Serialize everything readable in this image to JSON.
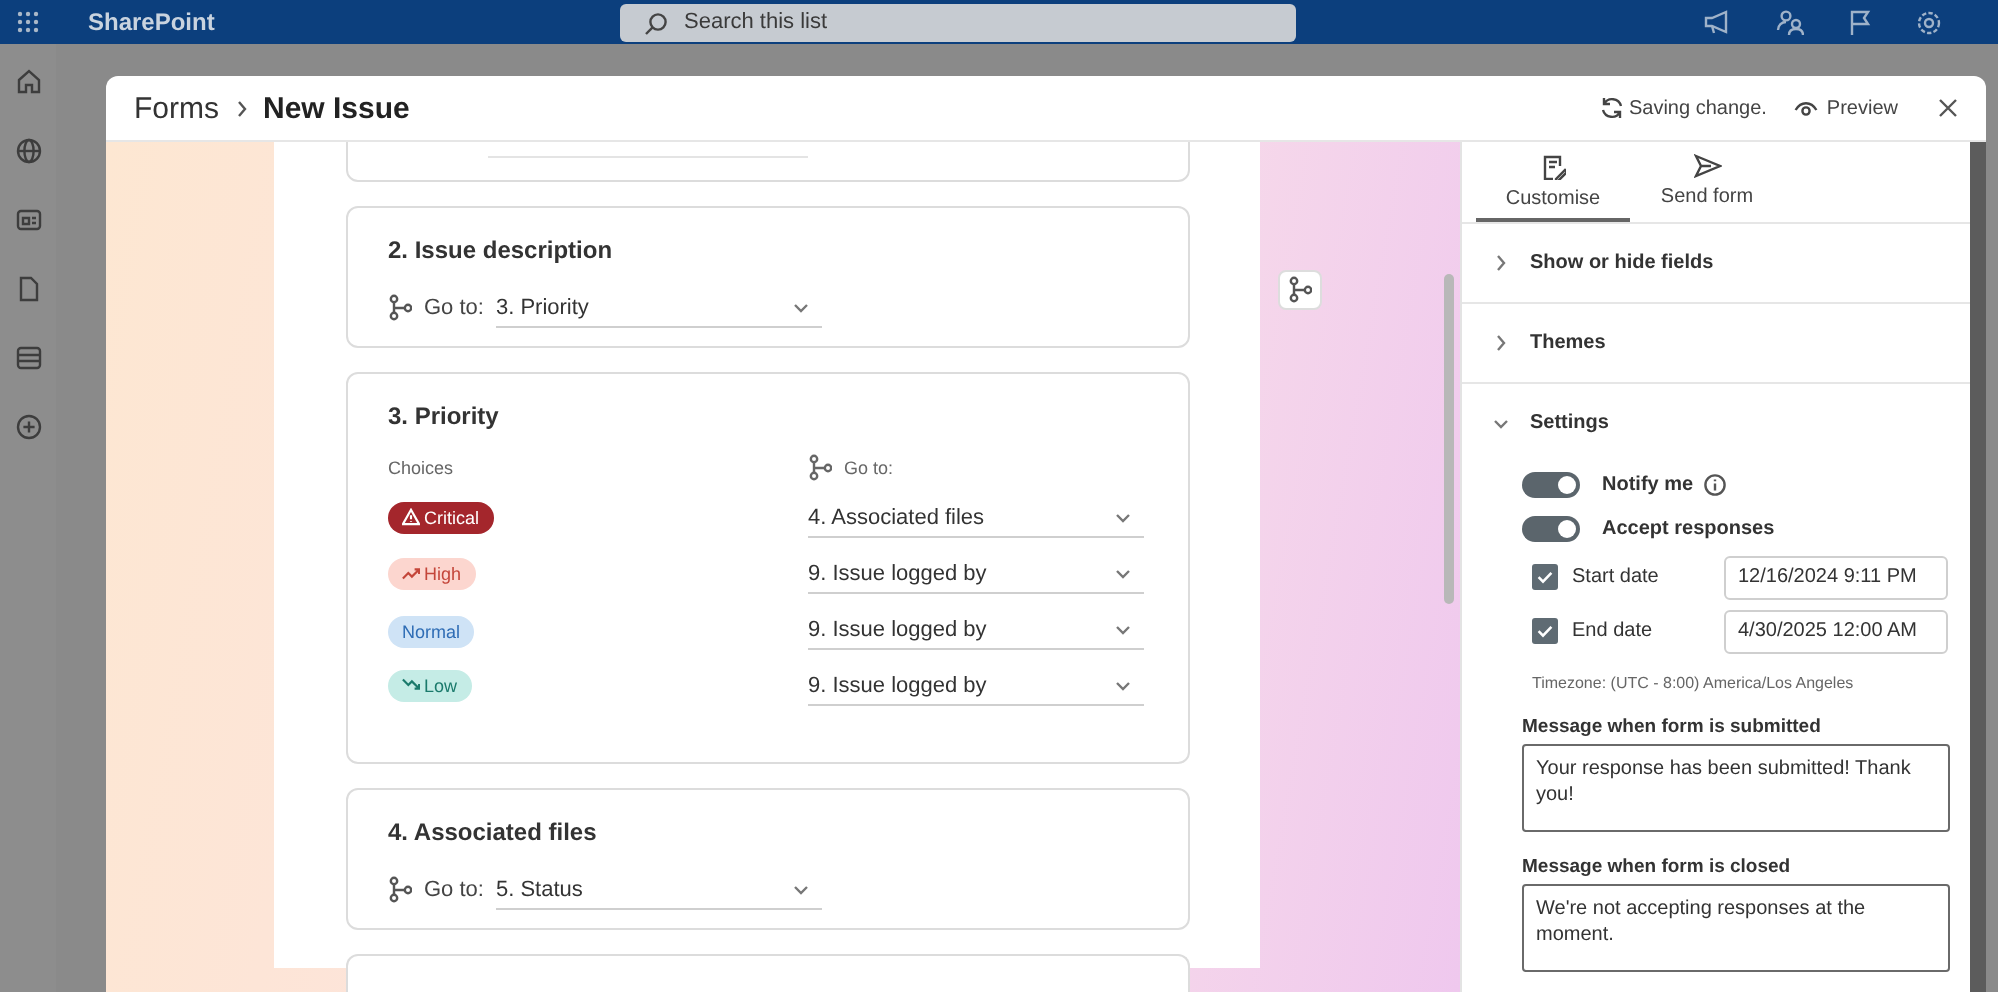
{
  "app_bar": {
    "title": "SharePoint",
    "search": {
      "placeholder": "Search this list"
    }
  },
  "dialog": {
    "breadcrumb": [
      {
        "label": "Forms"
      },
      {
        "label": "New Issue"
      }
    ],
    "status": "Saving change.",
    "preview": "Preview"
  },
  "form": {
    "questions": [
      {
        "kind": "cut"
      },
      {
        "kind": "branch",
        "title": "2. Issue description",
        "goto_label": "Go to:",
        "goto": "3. Priority"
      },
      {
        "kind": "choices",
        "title": "3. Priority",
        "choices_label": "Choices",
        "goto_label": "Go to:",
        "choices": [
          {
            "label": "Critical",
            "kind": "critical",
            "color": "#a4262c",
            "goto": "4. Associated files"
          },
          {
            "label": "High",
            "kind": "high",
            "color": "#fcd6cf",
            "goto": "9. Issue logged by"
          },
          {
            "label": "Normal",
            "kind": "normal",
            "color": "#cfe3f6",
            "goto": "9. Issue logged by"
          },
          {
            "label": "Low",
            "kind": "low",
            "color": "#c5ece6",
            "goto": "9. Issue logged by"
          }
        ]
      },
      {
        "kind": "branch",
        "title": "4. Associated files",
        "goto_label": "Go to:",
        "goto": "5. Status"
      },
      {
        "kind": "cut"
      }
    ]
  },
  "panel": {
    "tabs": [
      {
        "label": "Customise",
        "selected": true
      },
      {
        "label": "Send form",
        "selected": false
      }
    ],
    "sections": [
      {
        "label": "Show or hide fields",
        "expanded": false
      },
      {
        "label": "Themes",
        "expanded": false
      },
      {
        "label": "Settings",
        "expanded": true
      }
    ],
    "settings": {
      "toggles": [
        {
          "label": "Notify me",
          "on": true,
          "info": true
        },
        {
          "label": "Accept responses",
          "on": true,
          "info": false
        }
      ],
      "dates": [
        {
          "label": "Start date",
          "checked": true,
          "value": "12/16/2024 9:11 PM"
        },
        {
          "label": "End date",
          "checked": true,
          "value": "4/30/2025 12:00 AM"
        }
      ],
      "timezone": "Timezone: (UTC - 8:00) America/Los Angeles",
      "messages": [
        {
          "label": "Message when form is submitted",
          "value": "Your response has been submitted! Thank you!"
        },
        {
          "label": "Message when form is closed",
          "value": "We're not accepting responses at the moment."
        }
      ]
    }
  }
}
